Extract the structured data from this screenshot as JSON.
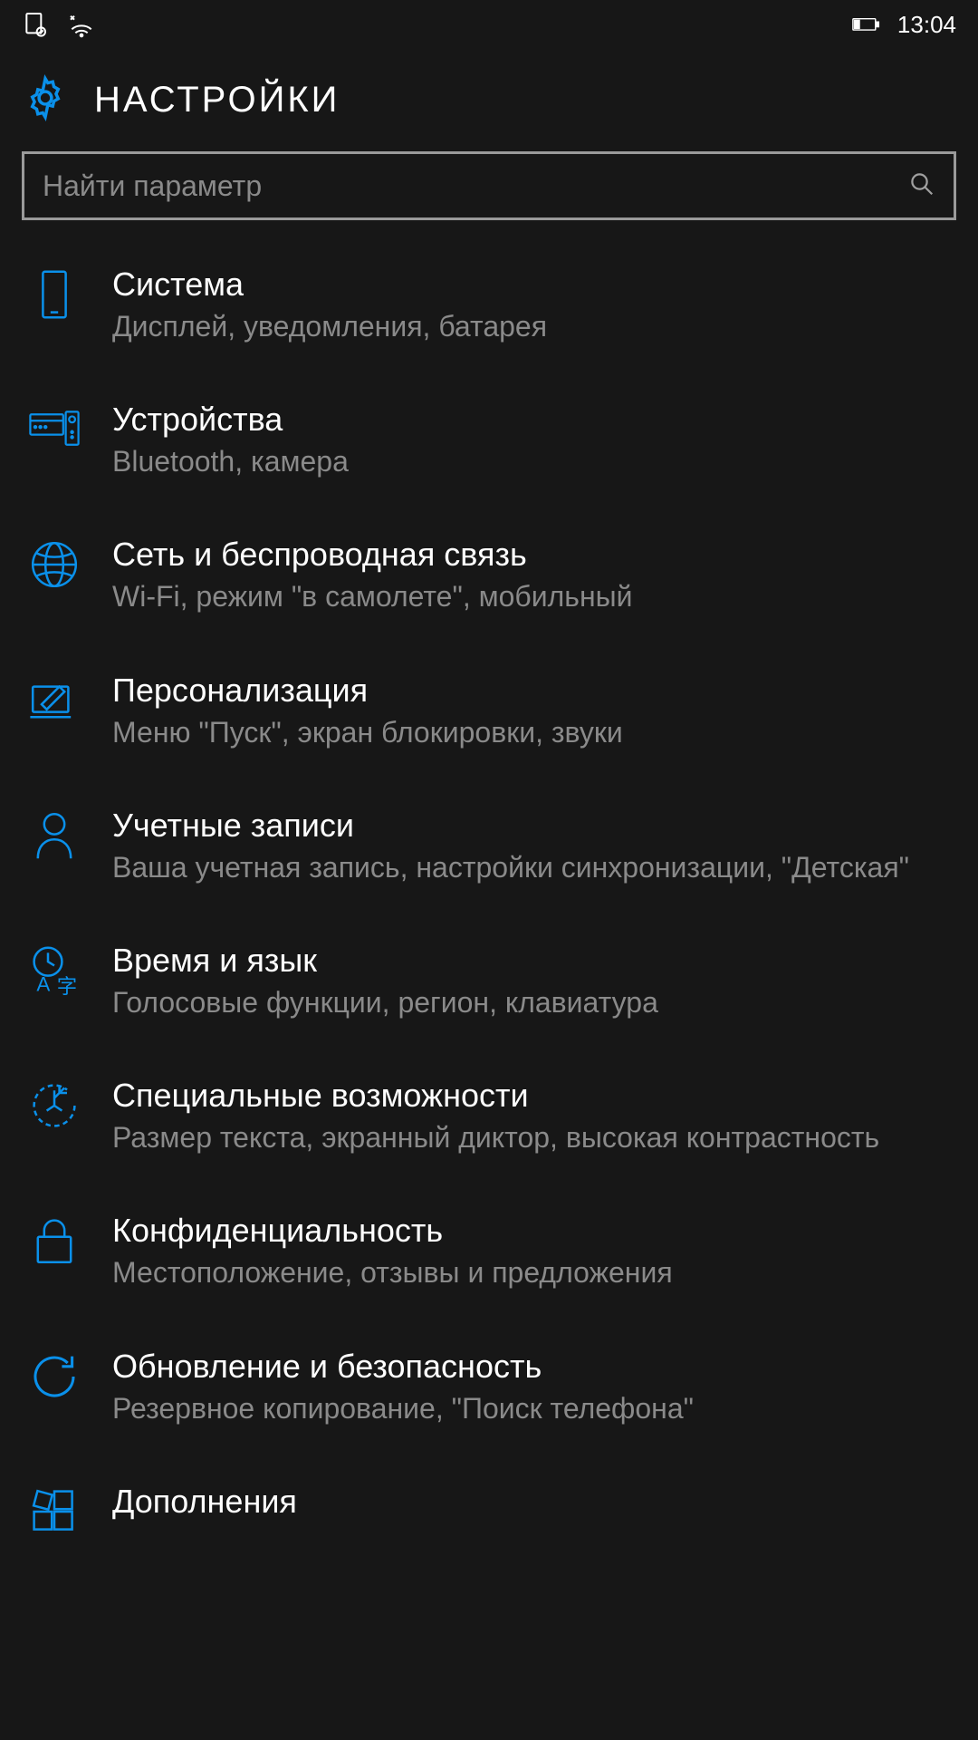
{
  "status": {
    "time": "13:04"
  },
  "header": {
    "title": "НАСТРОЙКИ"
  },
  "search": {
    "placeholder": "Найти параметр"
  },
  "accent": "#0a90ea",
  "items": [
    {
      "title": "Система",
      "sub": "Дисплей, уведомления, батарея"
    },
    {
      "title": "Устройства",
      "sub": "Bluetooth, камера"
    },
    {
      "title": "Сеть и беспроводная связь",
      "sub": "Wi-Fi, режим \"в самолете\", мобильный"
    },
    {
      "title": "Персонализация",
      "sub": "Меню \"Пуск\", экран блокировки, звуки"
    },
    {
      "title": "Учетные записи",
      "sub": "Ваша учетная запись, настройки синхронизации, \"Детская\""
    },
    {
      "title": "Время и язык",
      "sub": "Голосовые функции, регион, клавиатура"
    },
    {
      "title": "Специальные возможности",
      "sub": "Размер текста, экранный диктор, высокая контрастность"
    },
    {
      "title": "Конфиденциальность",
      "sub": "Местоположение, отзывы и предложения"
    },
    {
      "title": "Обновление и безопасность",
      "sub": "Резервное копирование, \"Поиск телефона\""
    },
    {
      "title": "Дополнения",
      "sub": ""
    }
  ]
}
